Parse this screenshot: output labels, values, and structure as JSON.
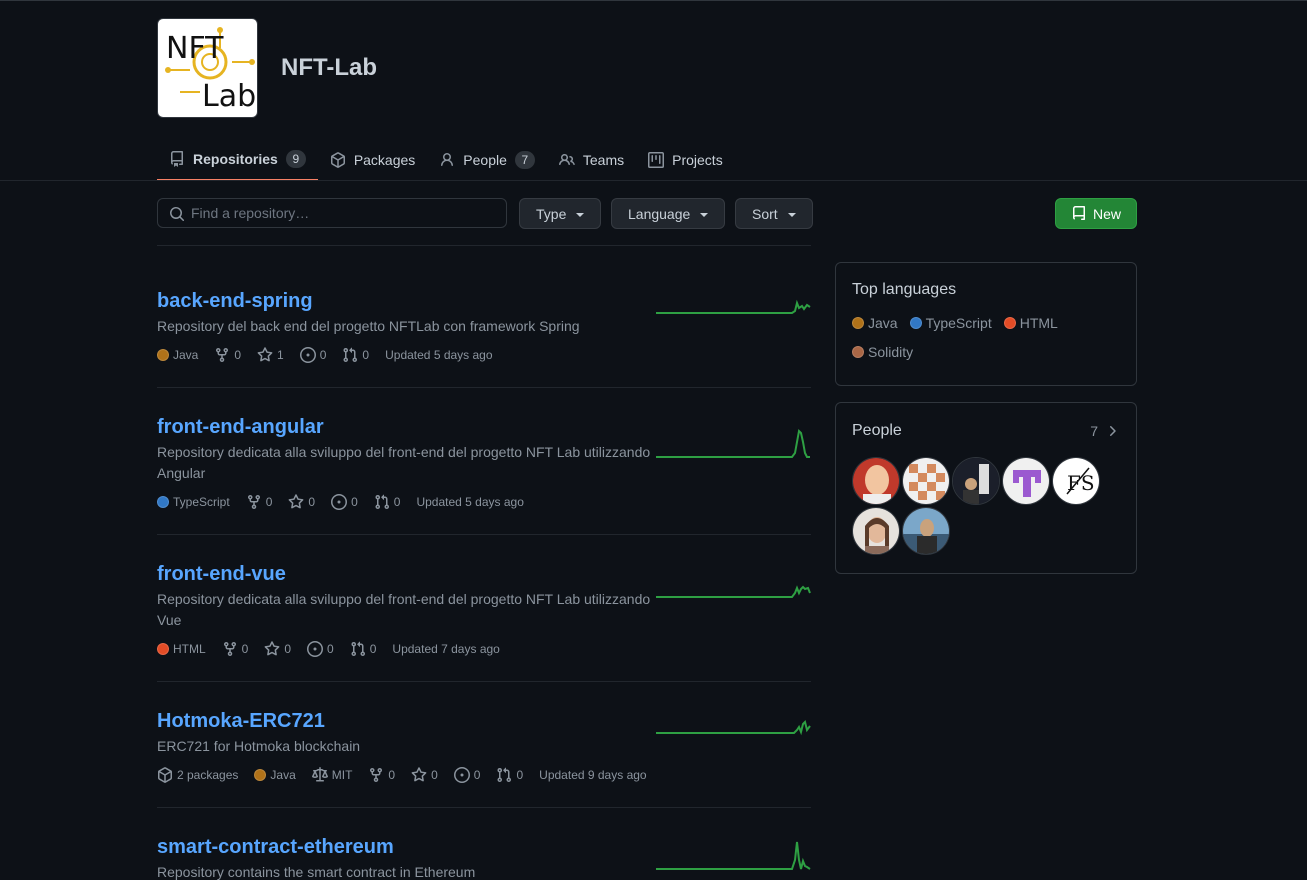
{
  "org": {
    "name": "NFT-Lab",
    "logo_text_top": "NFT",
    "logo_text_bottom": "Lab"
  },
  "nav": {
    "tabs": [
      {
        "label": "Repositories",
        "count": "9",
        "icon": "repo-icon"
      },
      {
        "label": "Packages",
        "icon": "package-icon"
      },
      {
        "label": "People",
        "count": "7",
        "icon": "person-icon"
      },
      {
        "label": "Teams",
        "icon": "people-icon"
      },
      {
        "label": "Projects",
        "icon": "project-icon"
      }
    ]
  },
  "filters": {
    "search_placeholder": "Find a repository…",
    "type_label": "Type",
    "language_label": "Language",
    "sort_label": "Sort",
    "new_label": "New"
  },
  "colors": {
    "Java": "#b07219",
    "TypeScript": "#3178c6",
    "HTML": "#e34c26",
    "Solidity": "#aa6746",
    "link": "#58a6ff",
    "new_button": "#238636",
    "spark": "#2ea043"
  },
  "repos": [
    {
      "name": "back-end-spring",
      "description": "Repository del back end del progetto NFTLab con framework Spring",
      "language": "Java",
      "forks": "0",
      "stars": "1",
      "issues": "0",
      "pulls": "0",
      "updated": "Updated 5 days ago"
    },
    {
      "name": "front-end-angular",
      "description": "Repository dedicata alla sviluppo del front-end del progetto NFT Lab utilizzando Angular",
      "language": "TypeScript",
      "forks": "0",
      "stars": "0",
      "issues": "0",
      "pulls": "0",
      "updated": "Updated 5 days ago"
    },
    {
      "name": "front-end-vue",
      "description": "Repository dedicata alla sviluppo del front-end del progetto NFT Lab utilizzando Vue",
      "language": "HTML",
      "forks": "0",
      "stars": "0",
      "issues": "0",
      "pulls": "0",
      "updated": "Updated 7 days ago"
    },
    {
      "name": "Hotmoka-ERC721",
      "description": "ERC721 for Hotmoka blockchain",
      "packages": "2 packages",
      "language": "Java",
      "license": "MIT",
      "forks": "0",
      "stars": "0",
      "issues": "0",
      "pulls": "0",
      "updated": "Updated 9 days ago"
    },
    {
      "name": "smart-contract-ethereum",
      "description": "Repository contains the smart contract in Ethereum"
    }
  ],
  "sidebar": {
    "top_languages_title": "Top languages",
    "languages": [
      "Java",
      "TypeScript",
      "HTML",
      "Solidity"
    ],
    "people_title": "People",
    "people_count": "7"
  }
}
